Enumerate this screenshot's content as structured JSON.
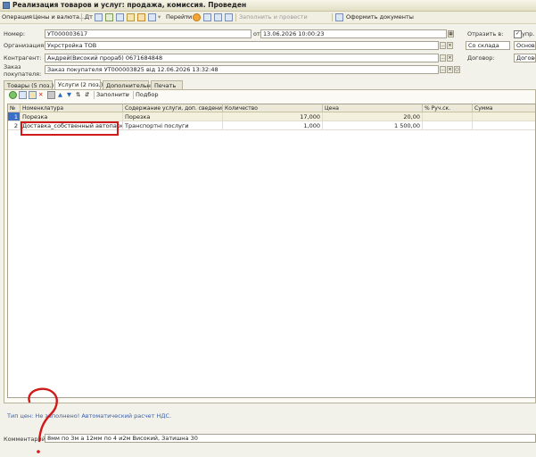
{
  "window": {
    "title": "Реализация товаров и услуг: продажа, комиссия. Проведен"
  },
  "toolbar": {
    "operation": "Операция",
    "prices_currency": "Цены и валюта...",
    "dt": "Дт",
    "goto": "Перейти",
    "fill_post": "Заполнить и провести",
    "make_docs": "Оформить документы"
  },
  "header": {
    "number_label": "Номер:",
    "number_value": "УТ000003617",
    "date_label": "от:",
    "date_value": "13.06.2026 10:00:23",
    "reflect_label": "Отразить в:",
    "upr_label": "упр. уч",
    "org_label": "Организация:",
    "org_value": "Укрстройка ТОВ",
    "warehouse_value": "Со склада",
    "main_value": "Основно",
    "counterparty_label": "Контрагент:",
    "counterparty_value": "Андрей(Високий прораб) 0671684848",
    "contract_label": "Договор:",
    "contract_value": "Договор",
    "order_label_1": "Заказ",
    "order_label_2": "покупателя:",
    "order_value": "Заказ покупателя УТ000003825 від 12.06.2026 13:32:48"
  },
  "tabs": [
    {
      "label": "Товары (5 поз.)"
    },
    {
      "label": "Услуги (2 поз.)"
    },
    {
      "label": "Дополнительно"
    },
    {
      "label": "Печать"
    }
  ],
  "subtoolbar": {
    "fill": "Заполнить",
    "select": "Подбор"
  },
  "table": {
    "columns": [
      "№",
      "Номенклатура",
      "Содержание услуги, доп. сведения",
      "Количество",
      "Цена",
      "% Руч.ск.",
      "Сумма"
    ],
    "rows": [
      {
        "n": "1",
        "item": "Порезка",
        "content": "Порезка",
        "qty": "17,000",
        "price": "20,00",
        "disc": "",
        "sum": ""
      },
      {
        "n": "2",
        "item": "Доставка_собственный автопарк",
        "content": "Транспортні послуги",
        "qty": "1,000",
        "price": "1 500,00",
        "disc": "",
        "sum": ""
      }
    ]
  },
  "footer": {
    "price_type": "Тип цен: Не заполнено! Автоматический расчет НДС.",
    "comment_label": "Комментарий:",
    "comment_value": "8мм по 3м а 12мм по 4 и2м Високий, Затишна 30"
  },
  "colors": {
    "annotation": "#d01a1a",
    "selection": "#3d6fc7"
  }
}
